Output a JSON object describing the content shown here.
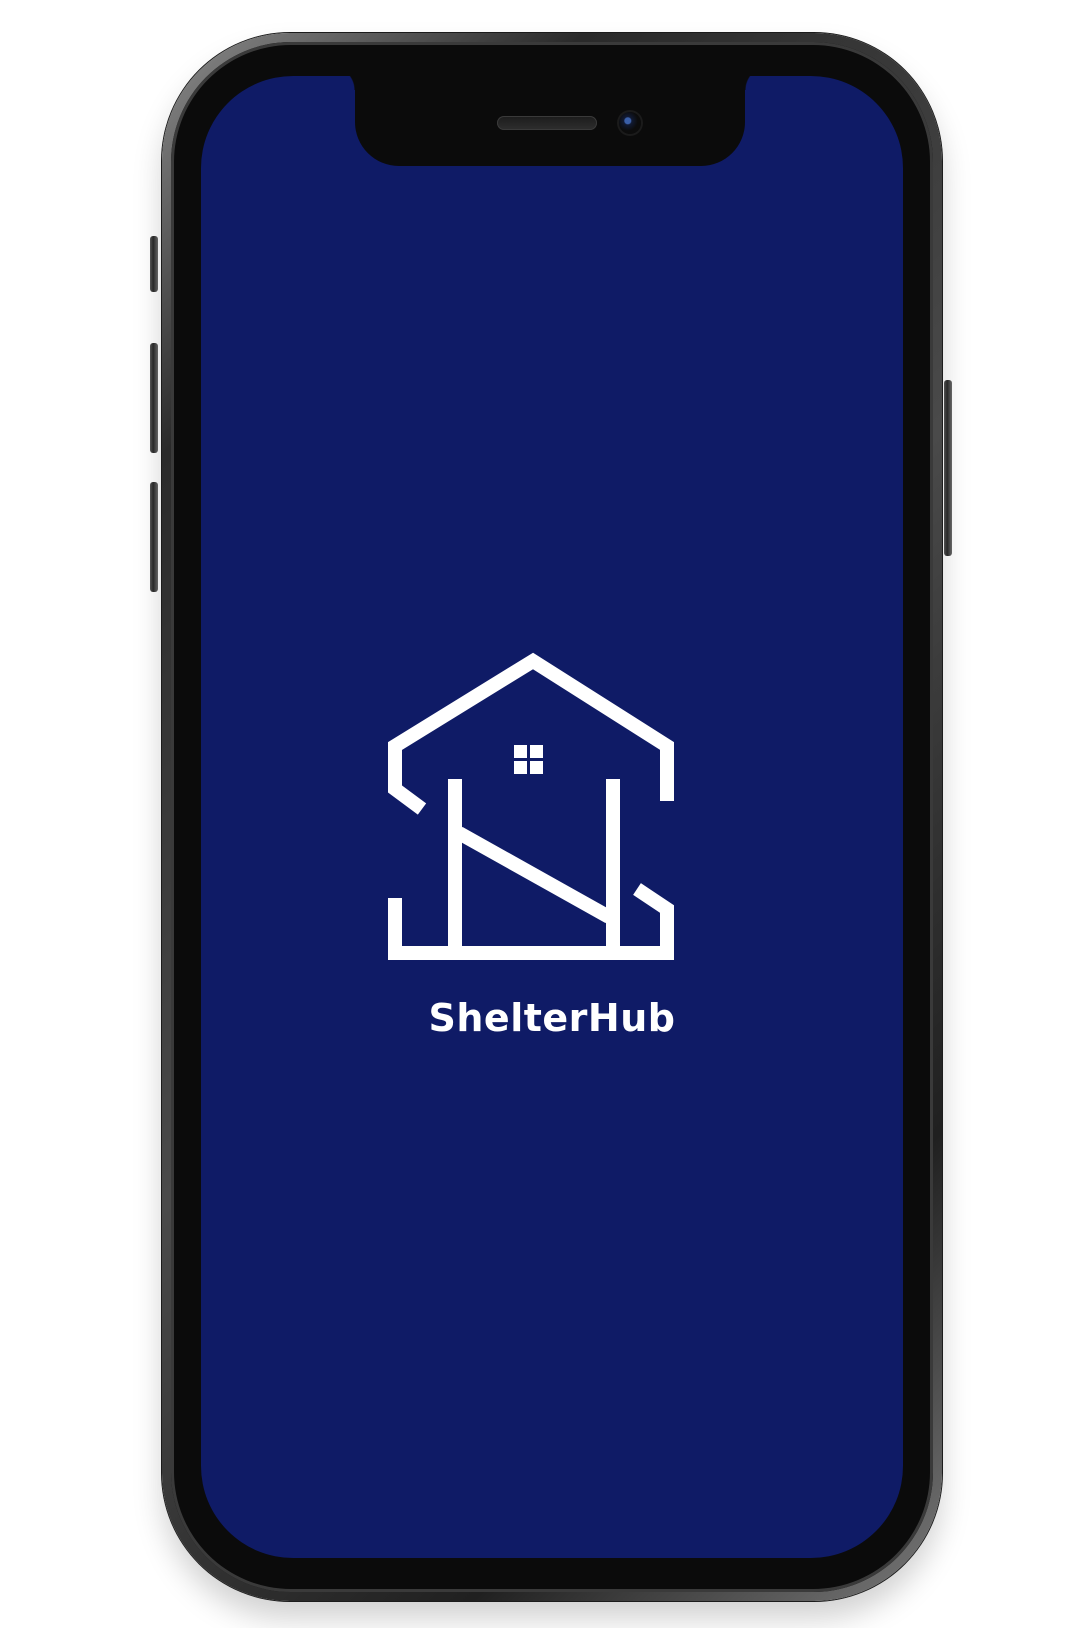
{
  "splash": {
    "app_name": "ShelterHub",
    "logo_icon": "shelterhub-house-logo-icon",
    "colors": {
      "background": "#0f1b66",
      "logo": "#ffffff",
      "text": "#ffffff"
    }
  }
}
